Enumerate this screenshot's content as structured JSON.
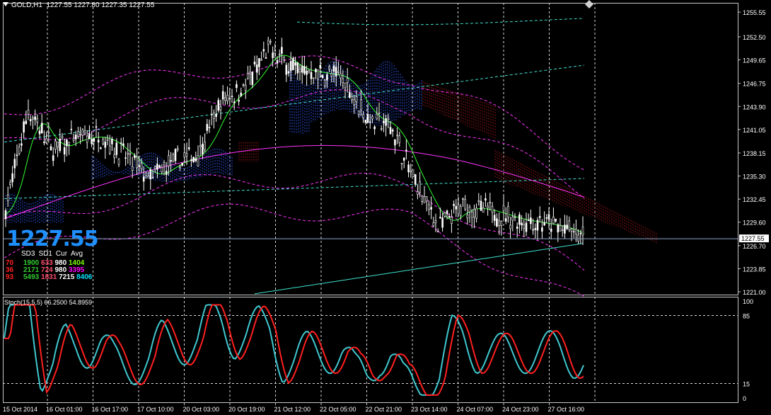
{
  "header": {
    "symbol": "GOLD,H1",
    "ohlc": "1227.55 1227.80 1227.35 1227.55"
  },
  "current_price": "1227.55",
  "price_axis": {
    "ticks": [
      "1255.55",
      "1252.50",
      "1249.65",
      "1246.75",
      "1243.90",
      "1241.05",
      "1238.15",
      "1235.30",
      "1232.45",
      "1229.60",
      "1226.70",
      "1223.85",
      "1221.00"
    ],
    "marker": "1227.55"
  },
  "time_axis": [
    "15 Oct 2014",
    "16 Oct 01:00",
    "16 Oct 17:00",
    "17 Oct 10:00",
    "20 Oct 03:00",
    "20 Oct 19:00",
    "21 Oct 12:00",
    "22 Oct 05:00",
    "22 Oct 21:00",
    "23 Oct 14:00",
    "24 Oct 07:00",
    "24 Oct 23:00",
    "27 Oct 16:00"
  ],
  "stochastic": {
    "label": "Stoch(15,5,5) 66.2500 54.8959",
    "levels": [
      "100",
      "85",
      "15",
      "0"
    ]
  },
  "panel": {
    "headers": [
      "SD3",
      "SD1",
      "Cur",
      "Avg"
    ],
    "row_labels": [
      "70",
      "36",
      "93"
    ],
    "rows": [
      [
        {
          "t": "1900",
          "c": "c0"
        },
        {
          "t": "633",
          "c": "c1"
        },
        {
          "t": "980",
          "c": "c2"
        },
        {
          "t": "1404",
          "c": "c3"
        }
      ],
      [
        {
          "t": "2171",
          "c": "c0"
        },
        {
          "t": "724",
          "c": "c1"
        },
        {
          "t": "980",
          "c": "c2"
        },
        {
          "t": "3395",
          "c": "c4"
        }
      ],
      [
        {
          "t": "5493",
          "c": "c0"
        },
        {
          "t": "1831",
          "c": "c1"
        },
        {
          "t": "7215",
          "c": "c2"
        },
        {
          "t": "8406",
          "c": "c5"
        }
      ]
    ]
  },
  "colors": {
    "background": "#000000",
    "grid": "#d8d8d8",
    "candle": "#ffffff",
    "ma_green": "#33ff33",
    "ma_magenta": "#ff33ff",
    "ma_cyan": "#40e0d0",
    "bands_magenta": "#ff33ff",
    "bands_cyan": "#40e0d0",
    "cloud_blue": "#3060ff",
    "cloud_red": "#a01818",
    "stoch_main": "#40c8d0",
    "stoch_signal": "#ff2020"
  },
  "chart_data": {
    "type": "candlestick",
    "ylim": [
      1221.0,
      1256.0
    ],
    "close_path": [
      {
        "x": "15 Oct 2014",
        "y": 1230.5
      },
      {
        "x": "15 Oct 20:00",
        "y": 1243.5
      },
      {
        "x": "16 Oct 01:00",
        "y": 1238.5
      },
      {
        "x": "16 Oct 09:00",
        "y": 1240.0
      },
      {
        "x": "16 Oct 17:00",
        "y": 1240.2
      },
      {
        "x": "17 Oct 02:00",
        "y": 1237.8
      },
      {
        "x": "17 Oct 10:00",
        "y": 1235.0
      },
      {
        "x": "17 Oct 18:00",
        "y": 1237.0
      },
      {
        "x": "20 Oct 03:00",
        "y": 1238.0
      },
      {
        "x": "20 Oct 11:00",
        "y": 1244.5
      },
      {
        "x": "20 Oct 19:00",
        "y": 1246.5
      },
      {
        "x": "21 Oct 04:00",
        "y": 1251.0
      },
      {
        "x": "21 Oct 12:00",
        "y": 1248.5
      },
      {
        "x": "21 Oct 20:00",
        "y": 1248.0
      },
      {
        "x": "22 Oct 05:00",
        "y": 1247.5
      },
      {
        "x": "22 Oct 13:00",
        "y": 1242.5
      },
      {
        "x": "22 Oct 21:00",
        "y": 1241.5
      },
      {
        "x": "23 Oct 06:00",
        "y": 1234.5
      },
      {
        "x": "23 Oct 14:00",
        "y": 1229.0
      },
      {
        "x": "23 Oct 22:00",
        "y": 1231.5
      },
      {
        "x": "24 Oct 07:00",
        "y": 1231.0
      },
      {
        "x": "24 Oct 15:00",
        "y": 1230.0
      },
      {
        "x": "24 Oct 23:00",
        "y": 1229.5
      },
      {
        "x": "27 Oct 08:00",
        "y": 1229.0
      },
      {
        "x": "27 Oct 16:00",
        "y": 1227.55
      }
    ]
  }
}
